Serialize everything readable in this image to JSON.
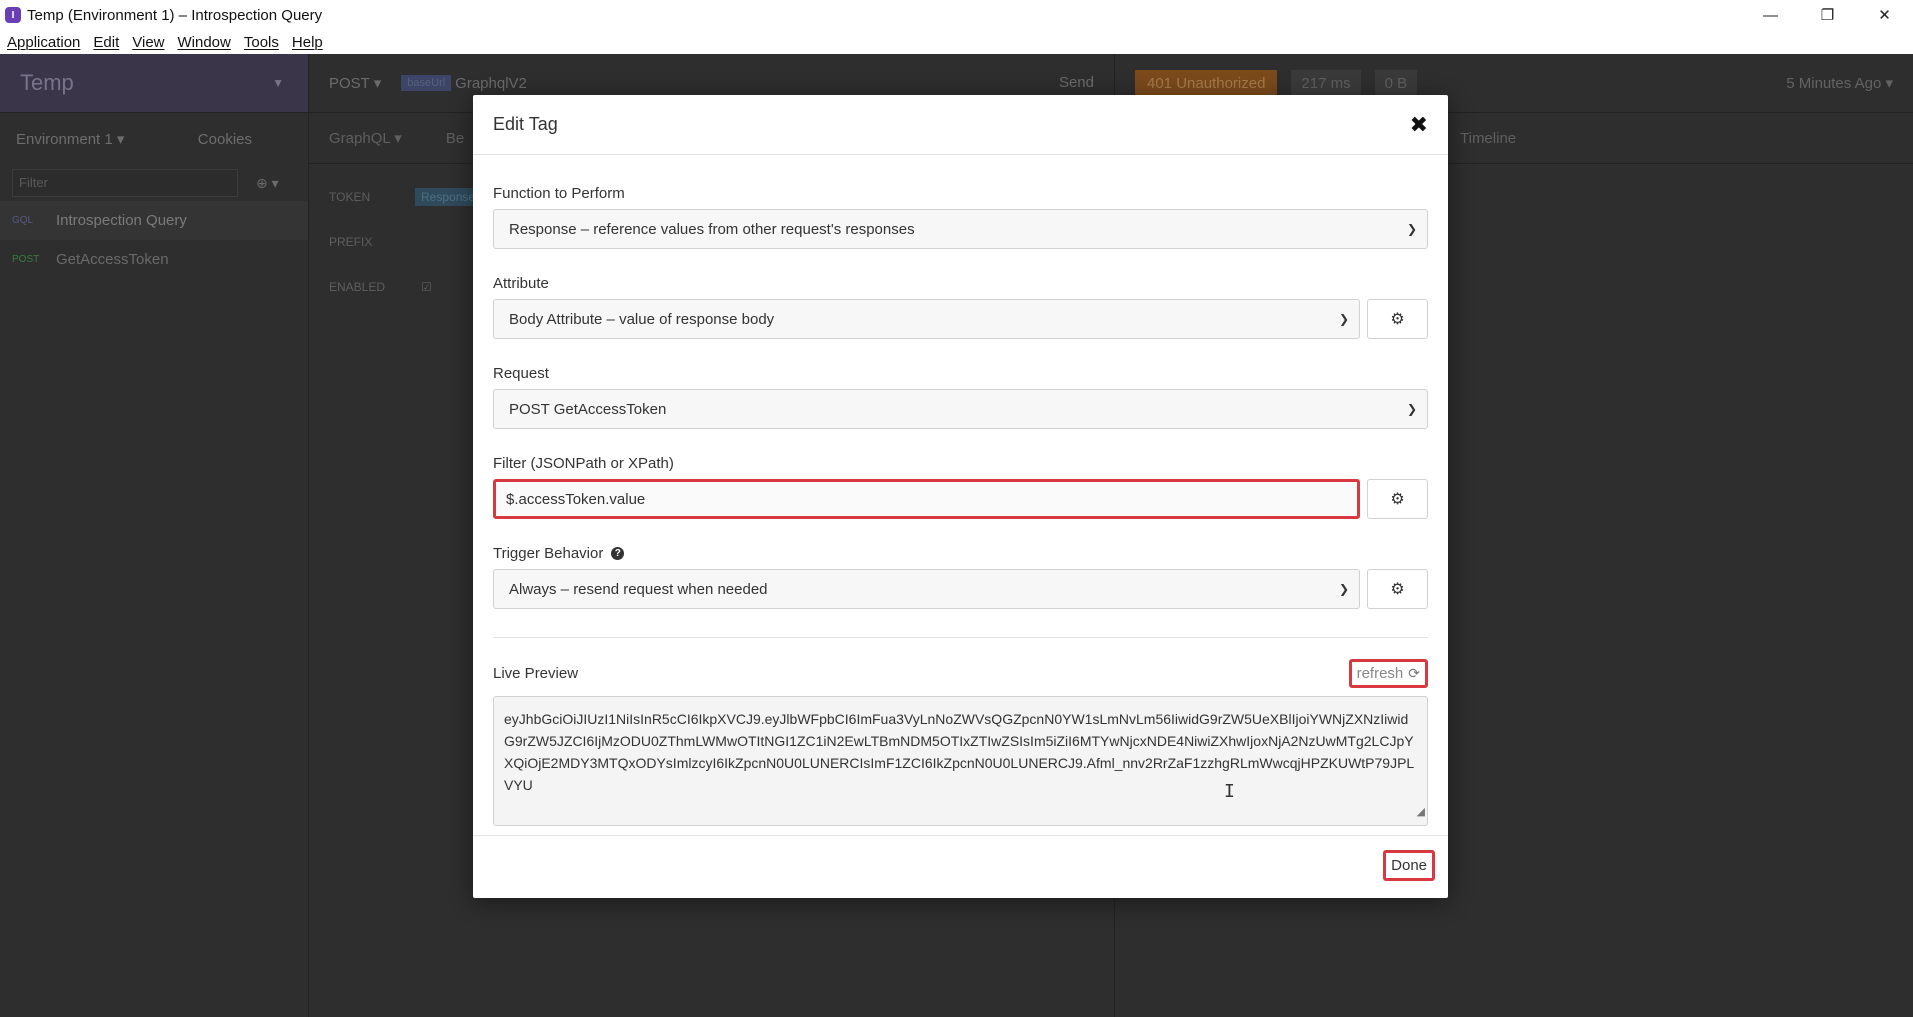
{
  "window": {
    "title": "Temp (Environment 1) – Introspection Query",
    "icon_glyph": "I",
    "minimize": "—",
    "restore": "❐",
    "close": "✕"
  },
  "menu": [
    "Application",
    "Edit",
    "View",
    "Window",
    "Tools",
    "Help"
  ],
  "sidebar": {
    "workspace": "Temp",
    "environment": "Environment 1 ▾",
    "cookies": "Cookies",
    "filter_placeholder": "Filter",
    "requests": [
      {
        "method": "GQL",
        "name": "Introspection Query"
      },
      {
        "method": "POST",
        "name": "GetAccessToken"
      }
    ]
  },
  "main": {
    "method": "POST ▾",
    "base_url": "baseUrl",
    "url_path": "GraphqlV2",
    "send": "Send",
    "tab_graphql": "GraphQL ▾",
    "tab_be": "Be",
    "token_label": "TOKEN",
    "token_badge": "Response",
    "prefix_label": "PREFIX",
    "enabled_label": "ENABLED"
  },
  "response": {
    "status": "401 Unauthorized",
    "time": "217 ms",
    "size": "0 B",
    "ago": "5 Minutes Ago ▾",
    "tab_timeline": "Timeline"
  },
  "modal": {
    "title": "Edit Tag",
    "function_label": "Function to Perform",
    "function_value": "Response – reference values from other request's responses",
    "attribute_label": "Attribute",
    "attribute_value": "Body Attribute – value of response body",
    "request_label": "Request",
    "request_value": "POST GetAccessToken",
    "filter_label": "Filter (JSONPath or XPath)",
    "filter_value": "$.accessToken.value",
    "trigger_label": "Trigger Behavior",
    "trigger_value": "Always – resend request when needed",
    "live_preview_label": "Live Preview",
    "refresh_label": "refresh",
    "preview_text": "eyJhbGciOiJIUzI1NiIsInR5cCI6IkpXVCJ9.eyJlbWFpbCI6ImFua3VyLnNoZWVsQGZpcnN0YW1sLmNvLm56IiwidG9rZW5UeXBlIjoiYWNjZXNzIiwidG9rZW5JZCI6IjMzODU0ZThmLWMwOTItNGI1ZC1iN2EwLTBmNDM5OTIxZTIwZSIsIm5iZiI6MTYwNjcxNDE4NiwiZXhwIjoxNjA2NzUwMTg2LCJpYXQiOjE2MDY3MTQxODYsImlzcyI6IkZpcnN0U0LUNERCIsImF1ZCI6IkZpcnN0U0LUNERCJ9.Afml_nnv2RrZaF1zzhgRLmWwcqjHPZKUWtP79JPLVYU",
    "done_label": "Done"
  }
}
